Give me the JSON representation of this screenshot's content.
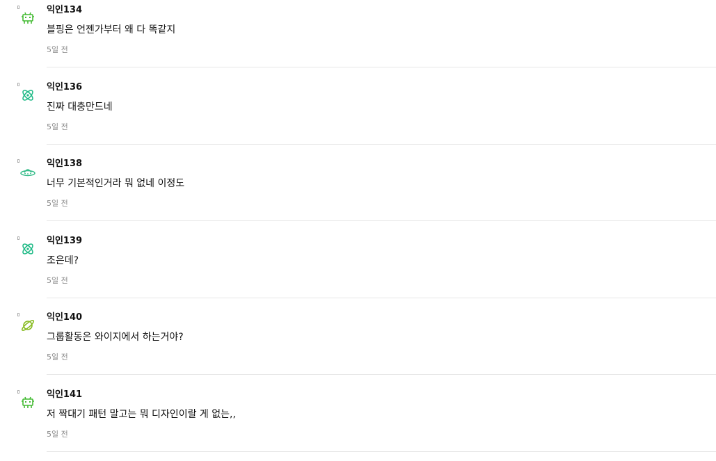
{
  "comments": [
    {
      "author": "익인134",
      "text": "블핑은 언젠가부터 왜 다 똑같지",
      "time": "5일 전",
      "avatar_icon": "alien-invader-icon",
      "avatar_color": "#44bb33"
    },
    {
      "author": "익인136",
      "text": "진짜 대충만드네",
      "time": "5일 전",
      "avatar_icon": "atom-icon",
      "avatar_color": "#22bb88"
    },
    {
      "author": "익인138",
      "text": "너무 기본적인거라 뭐 없네 이정도",
      "time": "5일 전",
      "avatar_icon": "ufo-icon",
      "avatar_color": "#33bb88"
    },
    {
      "author": "익인139",
      "text": "조은데?",
      "time": "5일 전",
      "avatar_icon": "atom-icon",
      "avatar_color": "#22bb88"
    },
    {
      "author": "익인140",
      "text": "그룹활동은 와이지에서 하는거야?",
      "time": "5일 전",
      "avatar_icon": "planet-icon",
      "avatar_color": "#88bb22"
    },
    {
      "author": "익인141",
      "text": "저 짝대기 패턴 말고는 뭐 디자인이랄 게 없는,,",
      "time": "5일 전",
      "avatar_icon": "alien-invader-icon",
      "avatar_color": "#44bb33"
    }
  ]
}
